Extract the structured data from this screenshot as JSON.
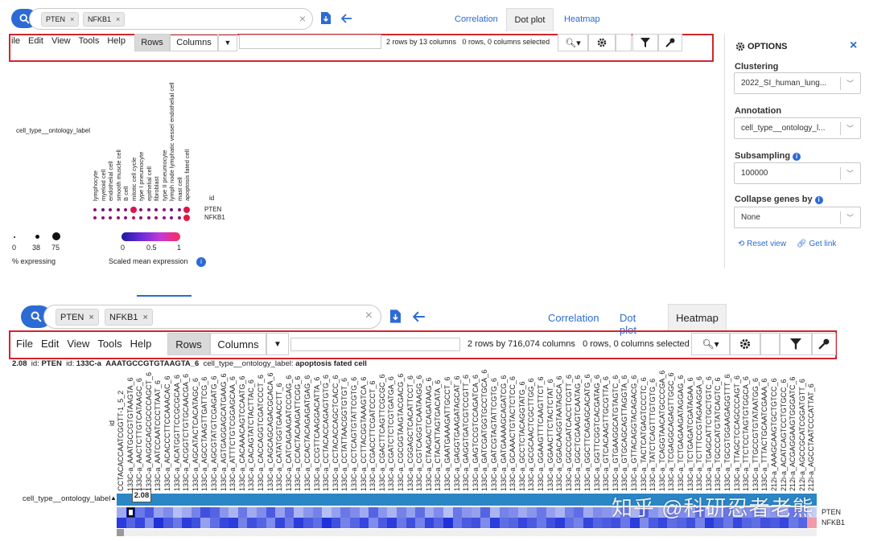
{
  "top": {
    "search": {
      "chips": [
        "PTEN",
        "NFKB1"
      ],
      "clear": "×"
    },
    "tabs": {
      "correlation": "Correlation",
      "dotplot": "Dot plot",
      "heatmap": "Heatmap"
    },
    "menu": [
      "ile",
      "Edit",
      "View",
      "Tools",
      "Help"
    ],
    "seg": {
      "rows": "Rows",
      "columns": "Columns"
    },
    "status": "2 rows by 13 columns   0 rows, 0 columns selected",
    "options": {
      "title": "OPTIONS",
      "clustering_label": "Clustering",
      "clustering_value": "2022_SI_human_lung...",
      "annotation_label": "Annotation",
      "annotation_value": "cell_type__ontology_l...",
      "subsampling_label": "Subsampling",
      "subsampling_value": "100000",
      "collapse_label": "Collapse genes by",
      "collapse_value": "None",
      "reset": "Reset view",
      "getlink": "Get link"
    },
    "dotplot": {
      "row_axis_label": "cell_type__ontology_label",
      "columns": [
        "lymphocyte",
        "myeloid cell",
        "endothelial cell",
        "smooth muscle cell",
        "B cell",
        "mitotic cell cycle",
        "type I pneumocyte",
        "epithelial cell",
        "fibroblast",
        "type II pneumocyte",
        "lymph node lymphatic vessel endothelial cell",
        "mast cell",
        "apoptosis fated cell"
      ],
      "id_label": "id",
      "rows": [
        "PTEN",
        "NFKB1"
      ],
      "values": [
        [
          0.55,
          0.35,
          0.45,
          0.4,
          0.5,
          0.95,
          0.5,
          0.45,
          0.35,
          0.6,
          0.3,
          0.45,
          0.95
        ],
        [
          0.6,
          0.55,
          0.5,
          0.6,
          0.45,
          0.75,
          0.55,
          0.5,
          0.6,
          0.55,
          0.5,
          0.55,
          1.0
        ]
      ],
      "legend_size_ticks": [
        "0",
        "38",
        "75"
      ],
      "legend_size_title": "% expressing",
      "legend_color_ticks": [
        "0",
        "0.5",
        "1"
      ],
      "legend_color_title": "Scaled mean expression"
    }
  },
  "bottom": {
    "search": {
      "chips": [
        "PTEN",
        "NFKB1"
      ],
      "clear": "×"
    },
    "tabs": {
      "correlation": "Correlation",
      "dotplot": "Dot plot",
      "heatmap": "Heatmap"
    },
    "menu": [
      "File",
      "Edit",
      "View",
      "Tools",
      "Help"
    ],
    "seg": {
      "rows": "Rows",
      "columns": "Columns"
    },
    "status": "2 rows by 716,074 columns   0 rows, 0 columns selected",
    "hover": {
      "value": "2.08",
      "id1_label": "id:",
      "id1": "PTEN",
      "id2_label": "id:",
      "id2a": "133C-a",
      "id2b": "AAATGCCGTGTAAGTA_6",
      "ct_label": "cell_type__ontology_label:",
      "ct": "apoptosis fated cell"
    },
    "heatmap": {
      "row_axis_label": "cell_type__ontology_label",
      "id_label": "id",
      "tooltip": "2.08",
      "rows": [
        "PTEN",
        "NFKB1"
      ],
      "columns": [
        "CCTACACCAATCGGTT-1_5_2",
        "133C-a_AAATGCCGTGTAAGTA_6",
        "133C-a_AACTCTTGTCATAAGC_6",
        "133C-a_AAGGCAGCGCCCAGCT_6",
        "133C-a_AATCCAATCCCTTAAT_6",
        "133C-a_ACACCCTTCCAAACAC_6",
        "133C-a_ACATGGTTCCGCGCAA_6",
        "133C-a_ACGGTCTGTGCAACGA_6",
        "133C-a_AGCATACTCACATAGC_6",
        "133C-a_AGCCTAAGTTGATTCG_6",
        "133C-a_AGCGTATGTCGAGATG_6",
        "133C-a_AGTGAGGAGCATGAAG_6",
        "133C-a_ATTTCTGTCGGAGCAA_6",
        "133C-a_CACAAACAGTCCAATG_6",
        "133C-a_CACAGTATCTACTTAC_6",
        "133C-a_CACCAGGTCGATCCCT_6",
        "133C-a_CAGCAGCAGACGCACA_6",
        "133C-a_CATATGGTGAACCTT_6",
        "133C-a_CATCAGAAGATCCGAG_6",
        "133C-a_CCACTACAAGATTCGG_6",
        "133C-a_CCACTACAGAGATGAG_6",
        "133C-a_CCGTTCAAGGACATTA_6",
        "133C-a_CCTACACCAGAGTGTG_6",
        "133C-a_CCTACACCAGCTCACC_6",
        "133C-a_CCTATTAACGGTGTGT_6",
        "133C-a_CCTCAGTGTATTCGTG_6",
        "133C-a_CCTTACGGTAAAGTCA_6",
        "133C-a_CGACCTTCGATCCCT_6",
        "133C-a_CGACTTCAGTTCGCGC_6",
        "133C-a_CGATCTCTCGTGATGA_6",
        "133C-a_CGCGGTAAGTACGACG_6",
        "133C-a_CGGAGCTCACATTCCT_6",
        "133C-a_CGTCAGGTCAATAAGG_6",
        "133C-a_CTAAGACTCAGATAAG_6",
        "133C-a_CTACATTAGTGACATA_6",
        "133C-a_GAATGAAAGATTGCCT_6",
        "133C-a_GAGGTGAAGATAGCAT_6",
        "133C-a_GAGGTGATCGTCCGTT_6",
        "133C-a_GAGTCCGTCCAGATCA_6",
        "133C-a_GATCGATGGTGCCTGCA_6",
        "133C-a_GATCGTAGTATTCGTG_6",
        "133C-a_GATGAAAAGCAGATCG_6",
        "133C-a_GCAAACTGTACTCTCC_6",
        "133C-a_GCCTCTACAGGTATG_6",
        "133C-a_GCGCAACTCGCTTGG_6",
        "133C-a_GGAAGTTTCAAGTTCT_6",
        "133C-a_GGAACTTCTACTCTAT_6",
        "133C-a_GGACAAGGTAATAGCA_6",
        "133C-a_GGCCGATCACCTCGTT_6",
        "133C-a_GGCTCGAAGTCAATAG_6",
        "133C-a_GGCTTCAGAGCACATG_6",
        "133C-a_GGTTCGGTCACGATAG_6",
        "133C-a_GTCACAAGTTGCGTTA_6",
        "133C-a_GTGAAGGCATGTAGTC_6",
        "133C-a_GTGCAGCAGTTAGGTA_6",
        "133C-a_GTTACAGGTACAGACG_6",
        "133C-a_TACTCATGAGTCCCTC_6",
        "133C-a_TATCTCAGTTTGTGTG_6",
        "133C-a_TCAGGTAACATGCCCGA_6",
        "133C-a_TCGAGGCAGAGTTGGC_6",
        "133C-a_TCTGAGAAGATAGGAG_6",
        "133C-a_TCTGAGATCGATAGAA_6",
        "133C-a_TCTTTCCGTAGAAGGA_6",
        "133C-a_TGAGCATTCTGCTGTC_6",
        "133C-a_TGCCCATGTATCAGTC_6",
        "133C-a_TGCGTGGAAGAGGTTT_6",
        "133C-a_TTAGCTCCAGCCCAGT_6",
        "133C-a_TTCTCCTAGTGTGGCA_6",
        "133C-a_TTGCCGTGTATAATGG_6",
        "133C-a_TTTACTGCAATCGAAA_6",
        "212i-a_AAAGCAAGTGCTGTCC_6",
        "212i-a_ACATCAGTCCTGTGCC_6",
        "212i-a_ACGAGGAAGTGGGATC_6",
        "212i-a_AGCCGCATCGGATGTT_6",
        "212i-a_AGCCTAATCCCATTAT_6"
      ],
      "values": [
        [
          0.35,
          1,
          0.6,
          0.75,
          0.4,
          0.5,
          0.25,
          0.35,
          0.55,
          0.8,
          0.7,
          0.45,
          0.3,
          0.6,
          0.35,
          0.5,
          0.75,
          0.4,
          0.65,
          0.3,
          0.45,
          0.55,
          0.25,
          0.4,
          0.6,
          0.5,
          0.35,
          0.7,
          0.45,
          0.3,
          0.55,
          0.4,
          0.65,
          0.35,
          0.5,
          0.25,
          0.6,
          0.45,
          0.4,
          0.7,
          0.3,
          0.55,
          0.5,
          0.35,
          0.45,
          0.6,
          0.4,
          0.3,
          0.55,
          0.65,
          0.35,
          0.5,
          0.45,
          0.4,
          0.6,
          0.3,
          0.7,
          0.45,
          0.35,
          0.55,
          0.5,
          0.4,
          0.65,
          0.3,
          0.45,
          0.6,
          0.35,
          0.5,
          0.55,
          0.4,
          0.45,
          0.35,
          0.6,
          0.5,
          0.2
        ],
        [
          0.9,
          0.7,
          0.85,
          0.5,
          0.95,
          0.75,
          0.6,
          0.9,
          0.8,
          0.4,
          0.65,
          0.85,
          0.9,
          0.55,
          0.8,
          0.7,
          0.5,
          0.85,
          0.6,
          0.9,
          0.75,
          0.65,
          0.95,
          0.8,
          0.55,
          0.7,
          0.85,
          0.5,
          0.75,
          0.9,
          0.6,
          0.8,
          0.55,
          0.85,
          0.7,
          0.95,
          0.6,
          0.75,
          0.8,
          0.5,
          0.9,
          0.65,
          0.7,
          0.85,
          0.75,
          0.6,
          0.8,
          0.9,
          0.65,
          0.55,
          0.85,
          0.7,
          0.75,
          0.8,
          0.6,
          0.9,
          0.5,
          0.75,
          0.85,
          0.65,
          0.7,
          0.8,
          0.55,
          0.9,
          0.75,
          0.6,
          0.85,
          0.7,
          0.65,
          0.8,
          0.75,
          0.85,
          0.6,
          0.7,
          0.1
        ]
      ],
      "row_labels": [
        "PTEN",
        "NFKB1"
      ]
    }
  },
  "watermark": "知乎 @科研忍者老熊",
  "colors": {
    "accent": "#2c6bd3",
    "red": "#d0262d",
    "heatBlue": "#1a2bd9",
    "annot": "#2a86c5"
  }
}
